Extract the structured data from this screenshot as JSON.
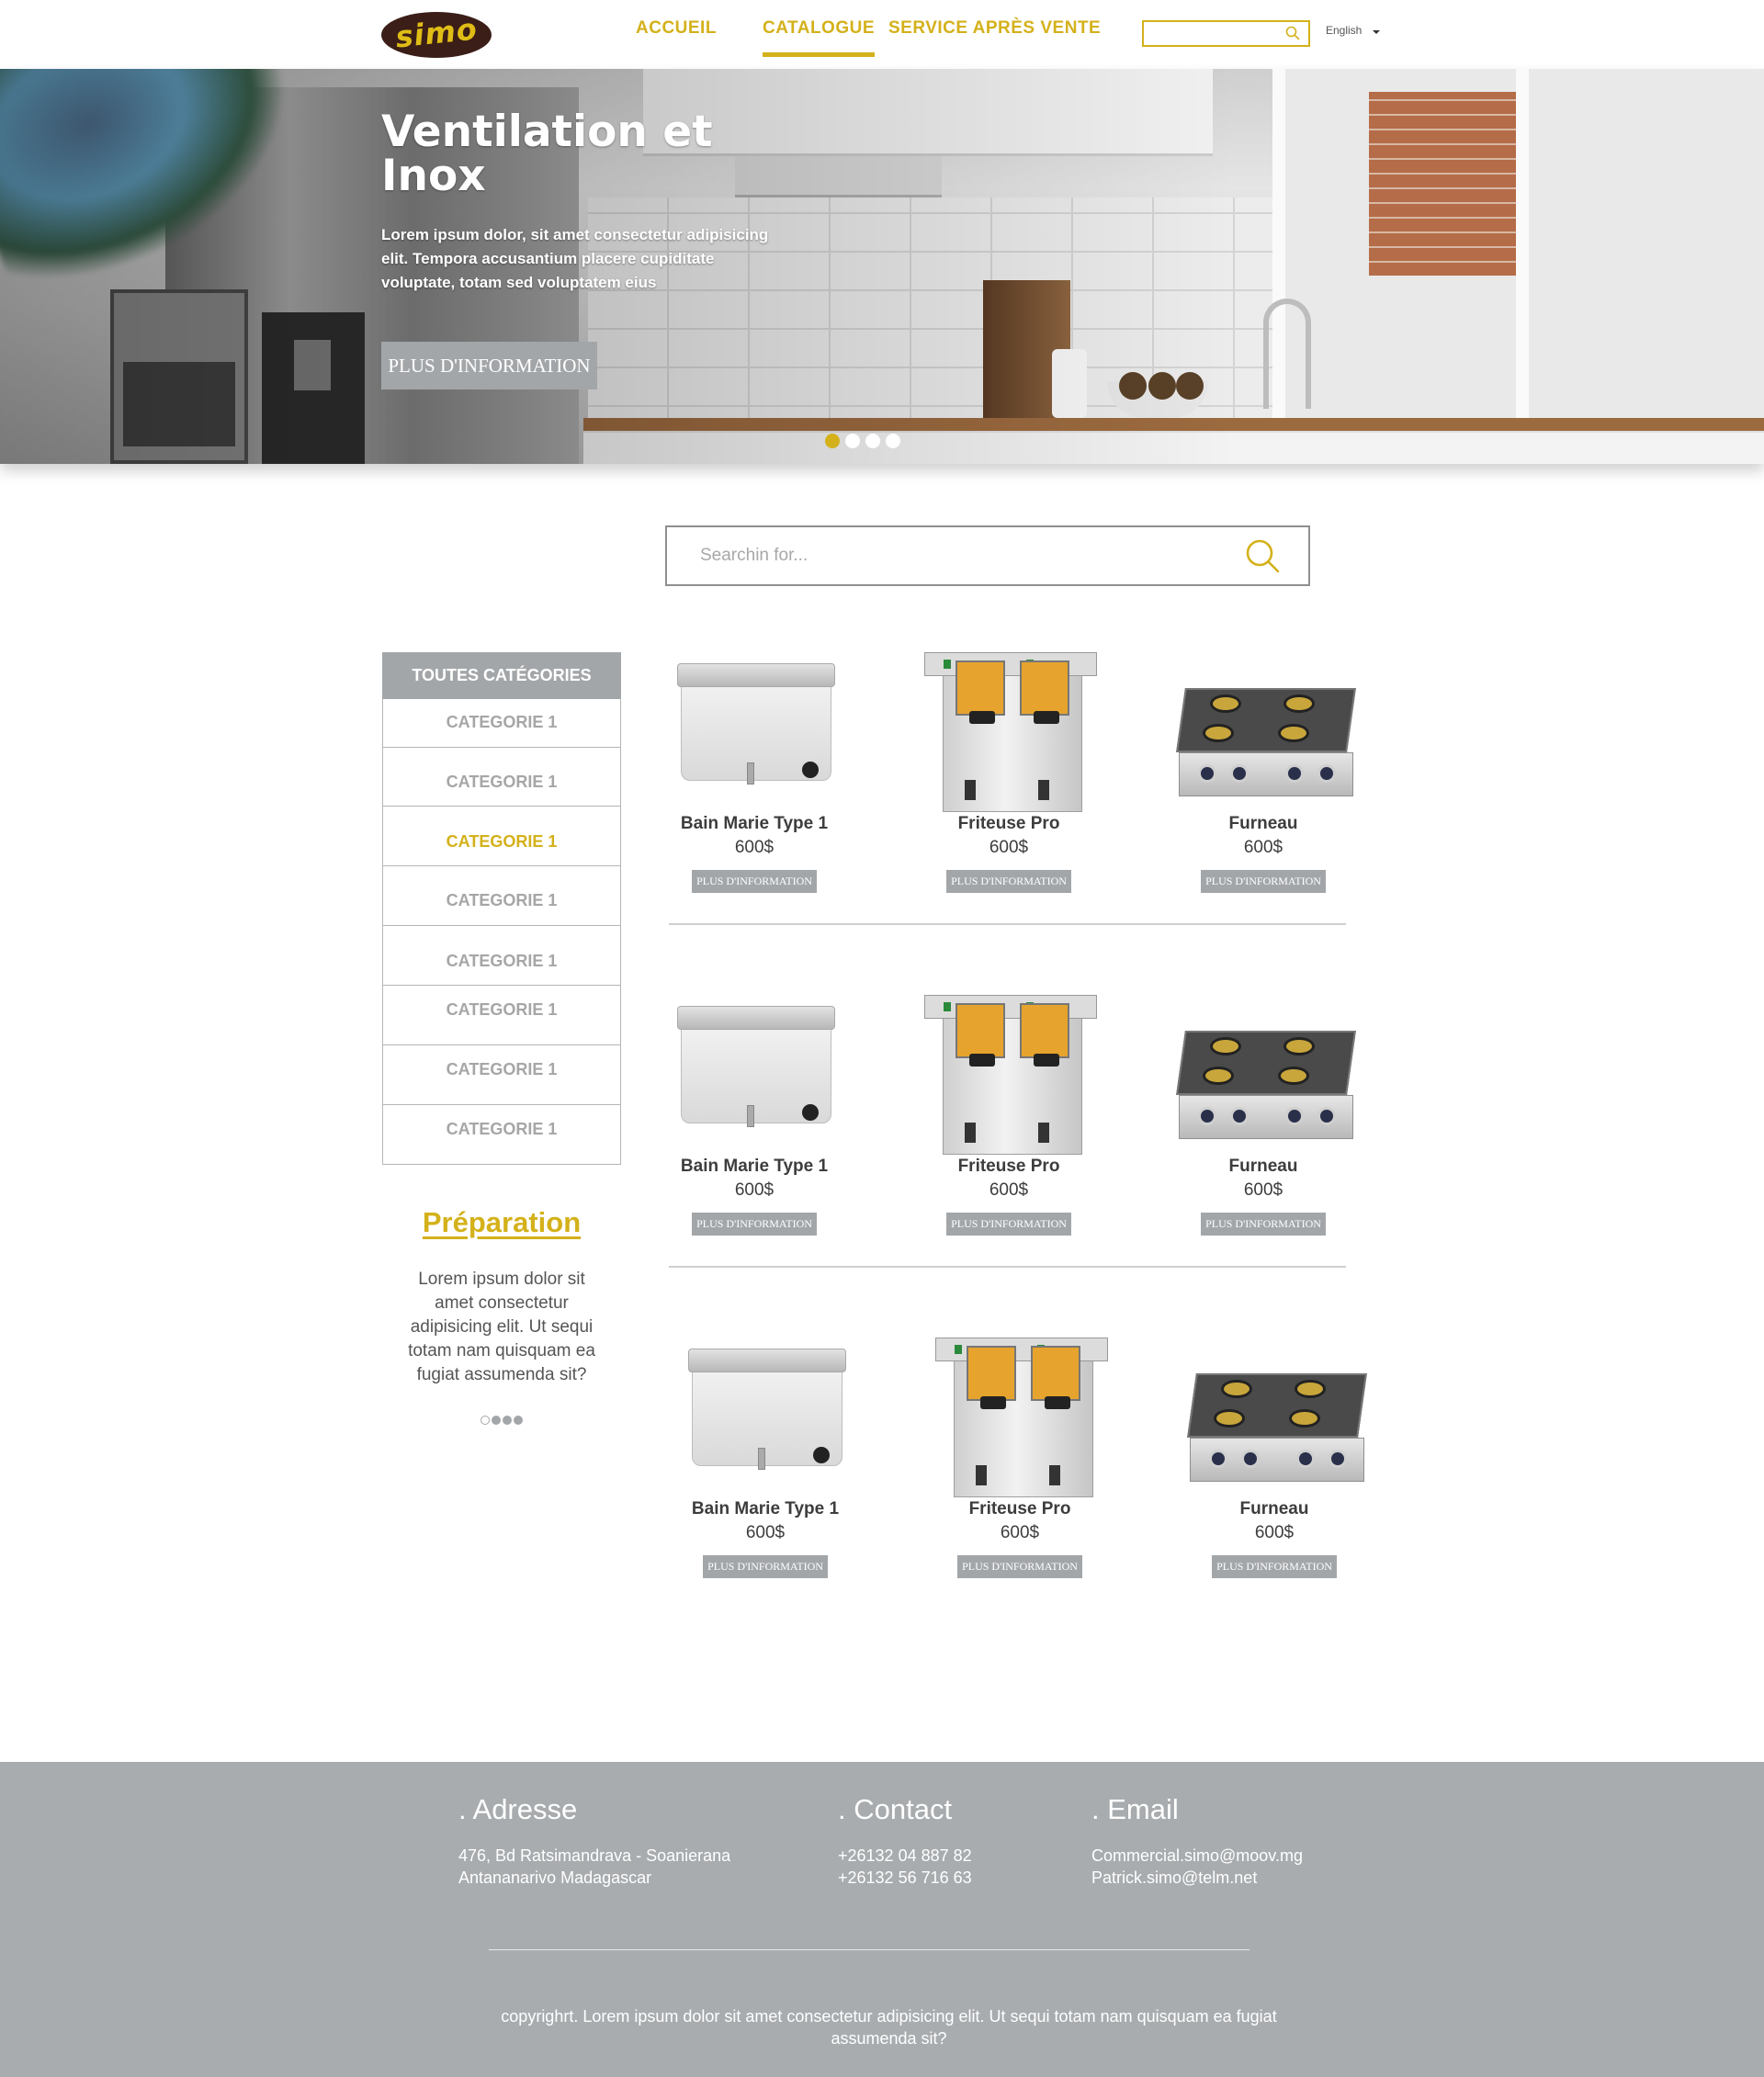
{
  "header": {
    "logo_text": "simo",
    "nav": [
      "ACCUEIL",
      "CATALOGUE",
      "SERVICE APRÈS VENTE"
    ],
    "active_nav": "CATALOGUE",
    "search_placeholder": "",
    "language": "English"
  },
  "hero": {
    "title": "Ventilation et Inox",
    "text": "Lorem ipsum dolor, sit amet consectetur adipisicing elit. Tempora accusantium placere cupiditate voluptate, totam sed voluptatem eius",
    "button": "PLUS D'INFORMATION",
    "slides": 4,
    "active_slide": 1
  },
  "search": {
    "placeholder": "Searchin for..."
  },
  "sidebar": {
    "heading": "TOUTES CATÉGORIES",
    "categories": [
      "CATEGORIE 1",
      "CATEGORIE 1",
      "CATEGORIE 1",
      "CATEGORIE 1",
      "CATEGORIE 1",
      "CATEGORIE 1",
      "CATEGORIE 1",
      "CATEGORIE 1"
    ],
    "active_index": 2,
    "promo": {
      "title": "Préparation",
      "text": "Lorem ipsum dolor sit amet consectetur adipisicing elit. Ut sequi totam nam quisquam ea fugiat assumenda sit?",
      "slides": 4,
      "active_slide": 1
    }
  },
  "products": {
    "button_label": "PLUS D'INFORMATION",
    "rows": [
      [
        {
          "name": "Bain Marie Type 1",
          "price": "600$",
          "icon": "bain-marie-image"
        },
        {
          "name": "Friteuse Pro",
          "price": "600$",
          "icon": "fryer-image"
        },
        {
          "name": "Furneau",
          "price": "600$",
          "icon": "stove-image"
        }
      ],
      [
        {
          "name": "Bain Marie Type 1",
          "price": "600$",
          "icon": "bain-marie-image"
        },
        {
          "name": "Friteuse Pro",
          "price": "600$",
          "icon": "fryer-image"
        },
        {
          "name": "Furneau",
          "price": "600$",
          "icon": "stove-image"
        }
      ],
      [
        {
          "name": "Bain Marie Type 1",
          "price": "600$",
          "icon": "bain-marie-image"
        },
        {
          "name": "Friteuse Pro",
          "price": "600$",
          "icon": "fryer-image"
        },
        {
          "name": "Furneau",
          "price": "600$",
          "icon": "stove-image"
        }
      ]
    ]
  },
  "footer": {
    "address": {
      "title": ". Adresse",
      "lines": [
        "476, Bd Ratsimandrava - Soanierana",
        "Antananarivo Madagascar"
      ]
    },
    "contact": {
      "title": ". Contact",
      "lines": [
        "+26132 04 887 82",
        "+26132 56 716 63"
      ]
    },
    "email": {
      "title": ". Email",
      "lines": [
        "Commercial.simo@moov.mg",
        "Patrick.simo@telm.net"
      ]
    },
    "copyright": "copyrighrt. Lorem ipsum dolor sit amet consectetur adipisicing elit. Ut sequi totam nam quisquam ea fugiat assumenda sit?"
  },
  "colors": {
    "accent": "#d4b11a",
    "button_gray": "#a3a6a9",
    "footer_bg": "#a8acaf",
    "logo_bg": "#3b1e17"
  }
}
